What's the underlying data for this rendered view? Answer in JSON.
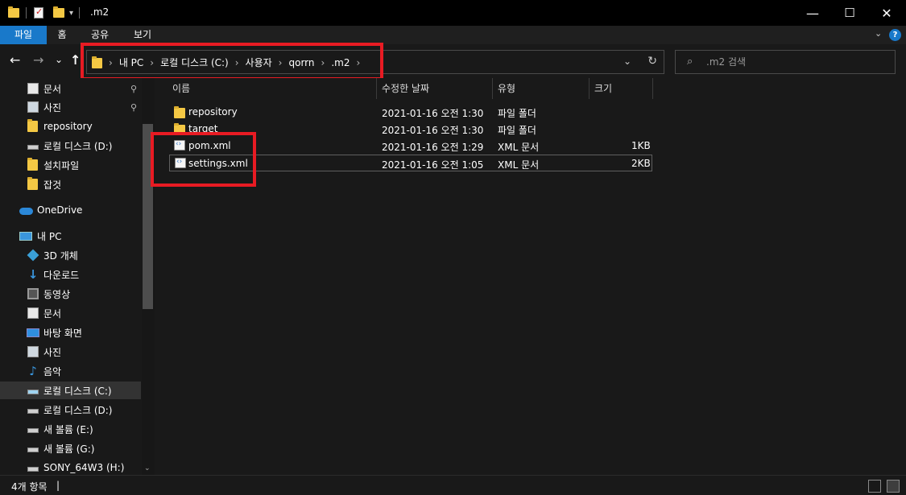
{
  "window": {
    "title": ".m2",
    "minimize": "—",
    "maximize": "☐",
    "close": "✕"
  },
  "ribbon": {
    "tabs": [
      {
        "label": "파일",
        "active": true
      },
      {
        "label": "홈"
      },
      {
        "label": "공유"
      },
      {
        "label": "보기"
      }
    ],
    "expand": "⌄",
    "help": "?"
  },
  "nav": {
    "back": "←",
    "forward": "→",
    "recent": "⌄",
    "up": "↑",
    "breadcrumb": [
      "내 PC",
      "로컬 디스크 (C:)",
      "사용자",
      "qorrn",
      ".m2"
    ],
    "separator": "›",
    "search_placeholder": ".m2 검색"
  },
  "sidebar": {
    "items": [
      {
        "label": "문서",
        "icon": "document-icon",
        "pinned": true
      },
      {
        "label": "사진",
        "icon": "pictures-icon",
        "pinned": true
      },
      {
        "label": "repository",
        "icon": "folder-icon"
      },
      {
        "label": "로컬 디스크 (D:)",
        "icon": "drive-icon"
      },
      {
        "label": "설치파일",
        "icon": "folder-icon"
      },
      {
        "label": "잡것",
        "icon": "folder-icon"
      },
      {
        "label": "OneDrive",
        "icon": "onedrive-icon"
      },
      {
        "label": "내 PC",
        "icon": "pc-icon"
      },
      {
        "label": "3D 개체",
        "icon": "3d-objects-icon"
      },
      {
        "label": "다운로드",
        "icon": "download-icon"
      },
      {
        "label": "동영상",
        "icon": "video-icon"
      },
      {
        "label": "문서",
        "icon": "document-icon"
      },
      {
        "label": "바탕 화면",
        "icon": "desktop-icon"
      },
      {
        "label": "사진",
        "icon": "pictures-icon"
      },
      {
        "label": "음악",
        "icon": "music-icon"
      },
      {
        "label": "로컬 디스크 (C:)",
        "icon": "drive-c-icon",
        "selected": true
      },
      {
        "label": "로컬 디스크 (D:)",
        "icon": "drive-icon"
      },
      {
        "label": "새 볼륨 (E:)",
        "icon": "drive-icon"
      },
      {
        "label": "새 볼륨 (G:)",
        "icon": "drive-icon"
      },
      {
        "label": "SONY_64W3 (H:)",
        "icon": "drive-icon"
      }
    ],
    "pin_glyph": "📌"
  },
  "columns": {
    "name": "이름",
    "modified": "수정한 날짜",
    "type": "유형",
    "size": "크기"
  },
  "files": [
    {
      "name": "repository",
      "modified": "2021-01-16 오전 1:30",
      "type": "파일 폴더",
      "size": "",
      "icon": "folder-icon"
    },
    {
      "name": "target",
      "modified": "2021-01-16 오전 1:30",
      "type": "파일 폴더",
      "size": "",
      "icon": "folder-icon"
    },
    {
      "name": "pom.xml",
      "modified": "2021-01-16 오전 1:29",
      "type": "XML 문서",
      "size": "1KB",
      "icon": "xml-file-icon"
    },
    {
      "name": "settings.xml",
      "modified": "2021-01-16 오전 1:05",
      "type": "XML 문서",
      "size": "2KB",
      "icon": "xml-file-icon",
      "selected": true
    }
  ],
  "status": {
    "count": "4개 항목",
    "cursor": "|"
  },
  "colors": {
    "accent": "#1979ca",
    "highlight_box": "#e81b23",
    "background": "#191919",
    "folder": "#f4c844"
  }
}
